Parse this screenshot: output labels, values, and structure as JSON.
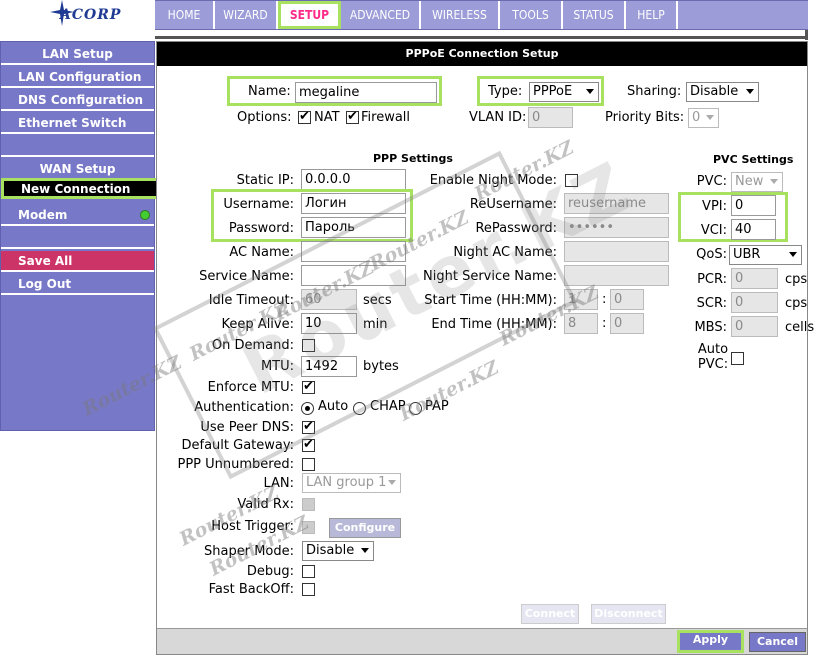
{
  "brand": {
    "logo_text": "ACORP"
  },
  "nav": {
    "tabs": [
      "HOME",
      "WIZARD",
      "SETUP",
      "ADVANCED",
      "WIRELESS",
      "TOOLS",
      "STATUS",
      "HELP"
    ],
    "active": "SETUP"
  },
  "sidebar": {
    "lan_header": "LAN Setup",
    "lan_configuration": "LAN Configuration",
    "dns_configuration": "DNS Configuration",
    "ethernet_switch": "Ethernet Switch",
    "wan_header": "WAN Setup",
    "new_connection": "New Connection",
    "modem": "Modem",
    "save_all": "Save All",
    "log_out": "Log Out"
  },
  "form": {
    "title": "PPPoE Connection Setup",
    "name_label": "Name:",
    "name_value": "megaline",
    "type_label": "Type:",
    "type_value": "PPPoE",
    "sharing_label": "Sharing:",
    "sharing_value": "Disable",
    "options_label": "Options:",
    "nat_label": "NAT",
    "firewall_label": "Firewall",
    "vlan_label": "VLAN ID:",
    "vlan_value": "0",
    "priority_label": "Priority Bits:",
    "priority_value": "0",
    "ppp_settings": "PPP Settings",
    "pvc_settings": "PVC Settings",
    "static_ip_label": "Static IP:",
    "static_ip_value": "0.0.0.0",
    "username_label": "Username:",
    "username_value": "Логин",
    "password_label": "Password:",
    "password_value": "Пароль",
    "ac_name_label": "AC Name:",
    "service_name_label": "Service Name:",
    "idle_timeout_label": "Idle Timeout:",
    "idle_timeout_value": "60",
    "secs": "secs",
    "keep_alive_label": "Keep Alive:",
    "keep_alive_value": "10",
    "min": "min",
    "on_demand_label": "On Demand:",
    "mtu_label": "MTU:",
    "mtu_value": "1492",
    "bytes": "bytes",
    "enforce_mtu_label": "Enforce MTU:",
    "authentication_label": "Authentication:",
    "auth_auto": "Auto",
    "auth_chap": "CHAP",
    "auth_pap": "PAP",
    "use_peer_dns_label": "Use Peer DNS:",
    "default_gateway_label": "Default Gateway:",
    "ppp_unnumbered_label": "PPP Unnumbered:",
    "lan_label": "LAN:",
    "lan_value": "LAN group 1",
    "valid_rx_label": "Valid Rx:",
    "host_trigger_label": "Host Trigger:",
    "configure": "Configure",
    "shaper_mode_label": "Shaper Mode:",
    "shaper_mode_value": "Disable",
    "debug_label": "Debug:",
    "fast_backoff_label": "Fast BackOff:",
    "enable_night_mode_label": "Enable Night Mode:",
    "reusername_label": "ReUsername:",
    "reusername_placeholder": "reusername",
    "repassword_label": "RePassword:",
    "repassword_value": "••••••",
    "night_ac_name_label": "Night AC Name:",
    "night_service_name_label": "Night Service Name:",
    "start_time_label": "Start Time (HH:MM):",
    "start_time_h": "1",
    "start_time_m": "0",
    "end_time_label": "End Time (HH:MM):",
    "end_time_h": "8",
    "end_time_m": "0",
    "colon": ":",
    "connect": "Connect",
    "disconnect": "Disconnect",
    "pvc_label": "PVC:",
    "pvc_value": "New",
    "vpi_label": "VPI:",
    "vpi_value": "0",
    "vci_label": "VCI:",
    "vci_value": "40",
    "qos_label": "QoS:",
    "qos_value": "UBR",
    "pcr_label": "PCR:",
    "pcr_value": "0",
    "scr_label": "SCR:",
    "scr_value": "0",
    "mbs_label": "MBS:",
    "mbs_value": "0",
    "cps": "cps",
    "cells": "cells",
    "auto_pvc_label": "Auto PVC:",
    "apply": "Apply",
    "cancel": "Cancel"
  },
  "watermarks": [
    "Router.KZ",
    "Router.KZ",
    "Router.KZ",
    "Router.KZ",
    "Router.KZ",
    "Router.KZ",
    "Router.KZ",
    "Router.KZ",
    "Router.KZ"
  ],
  "stamp_text": "Router.KZ"
}
